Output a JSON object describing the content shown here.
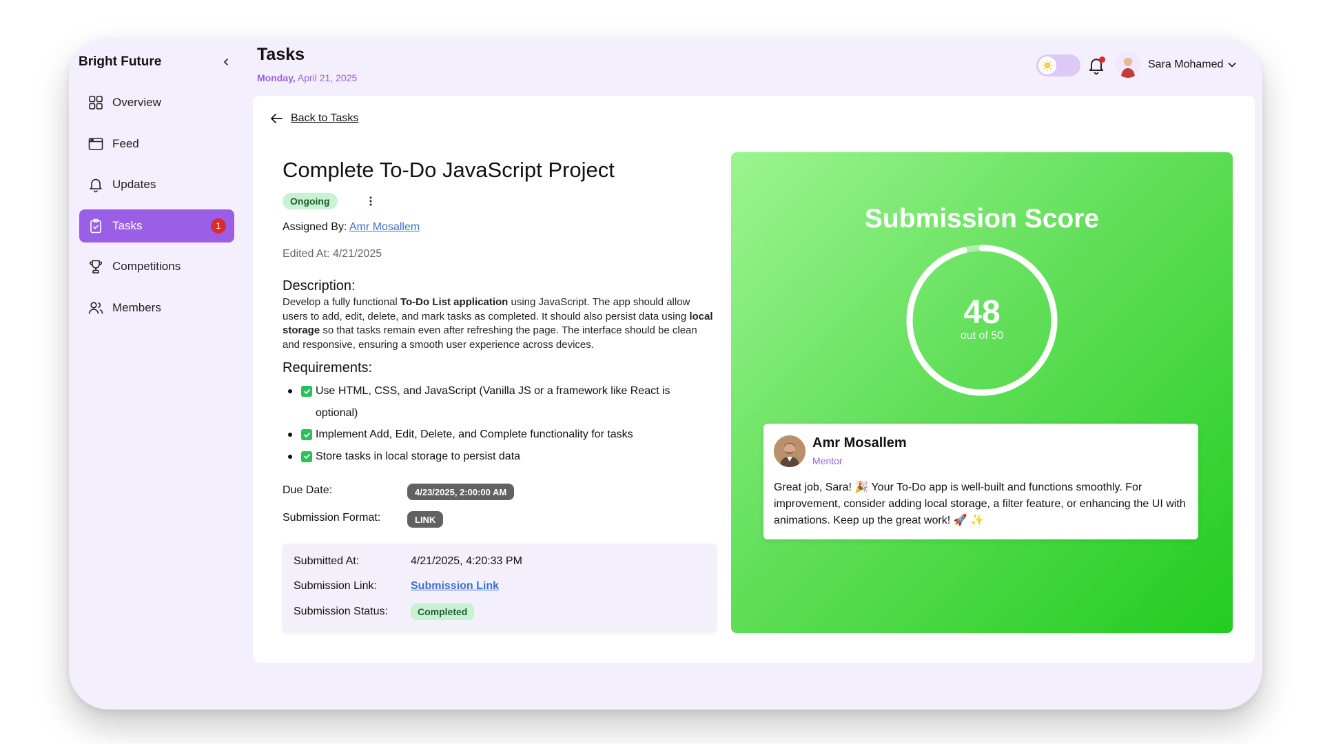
{
  "sidebar": {
    "brand": "Bright Future",
    "items": [
      {
        "label": "Overview",
        "icon": "grid-icon"
      },
      {
        "label": "Feed",
        "icon": "browser-window-icon"
      },
      {
        "label": "Updates",
        "icon": "bell-icon"
      },
      {
        "label": "Tasks",
        "icon": "clipboard-check-icon",
        "active": true,
        "badge": "1"
      },
      {
        "label": "Competitions",
        "icon": "trophy-icon"
      },
      {
        "label": "Members",
        "icon": "users-icon"
      }
    ]
  },
  "header": {
    "title": "Tasks",
    "date_day": "Monday,",
    "date_rest": " April 21, 2025",
    "user_name": "Sara Mohamed"
  },
  "task": {
    "back_label": "Back to Tasks",
    "title": "Complete To-Do JavaScript Project",
    "status": "Ongoing",
    "assigned_label": "Assigned By: ",
    "assigned_by": "Amr Mosallem",
    "edited": "Edited At: 4/21/2025",
    "description_heading": "Description:",
    "description": {
      "p1": "Develop a fully functional ",
      "b1": "To-Do List application",
      "p2": " using JavaScript. The app should allow users to add, edit, delete, and mark tasks as completed. It should also persist data using ",
      "b2": "local storage",
      "p3": " so that tasks remain even after refreshing the page. The interface should be clean and responsive, ensuring a smooth user experience across devices."
    },
    "requirements_heading": "Requirements:",
    "requirements": [
      "Use HTML, CSS, and JavaScript (Vanilla JS or a framework like React is optional)",
      "Implement Add, Edit, Delete, and Complete functionality for tasks",
      "Store tasks in local storage to persist data"
    ],
    "due_label": "Due Date:",
    "due_value": "4/23/2025, 2:00:00 AM",
    "format_label": "Submission Format:",
    "format_value": "LINK"
  },
  "submission": {
    "submitted_label": "Submitted At:",
    "submitted_value": "4/21/2025, 4:20:33 PM",
    "link_label": "Submission Link:",
    "link_value": "Submission Link",
    "status_label": "Submission Status:",
    "status_value": "Completed"
  },
  "score": {
    "title": "Submission Score",
    "value": 48,
    "max": 50,
    "out_of_label": "out of 50"
  },
  "feedback": {
    "name": "Amr Mosallem",
    "role": "Mentor",
    "text": "Great job, Sara! 🎉 Your To-Do app is well-built and functions smoothly. For improvement, consider adding local storage, a filter feature, or enhancing the UI with animations. Keep up the great work! 🚀 ✨"
  },
  "colors": {
    "accent": "#9b5ee6",
    "success": "#27c25a",
    "danger": "#e0282f"
  }
}
